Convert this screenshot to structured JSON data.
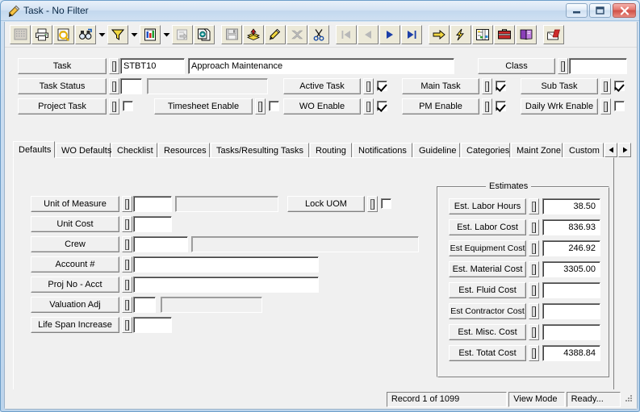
{
  "window": {
    "title": "Task - No Filter",
    "icon": "pencil-icon",
    "buttons": {
      "minimize": "minimize-icon",
      "maximize": "maximize-icon",
      "close": "close-icon"
    }
  },
  "toolbar": {
    "items": [
      {
        "name": "grid-icon",
        "enabled": false
      },
      {
        "name": "print-icon",
        "enabled": true
      },
      {
        "name": "print-preview-icon",
        "enabled": true
      },
      {
        "name": "find-icon",
        "enabled": true
      },
      {
        "name": "find-dropdown-icon",
        "enabled": true
      },
      {
        "name": "filter-icon",
        "enabled": true
      },
      {
        "name": "filter-dropdown-icon",
        "enabled": true
      },
      {
        "name": "report-icon",
        "enabled": true
      },
      {
        "name": "report-dropdown-icon",
        "enabled": true
      },
      {
        "name": "export-icon",
        "enabled": false
      },
      {
        "name": "copy-record-icon",
        "enabled": true
      },
      {
        "name": "save-icon",
        "enabled": false
      },
      {
        "name": "add-record-icon",
        "enabled": true
      },
      {
        "name": "edit-record-icon",
        "enabled": true
      },
      {
        "name": "delete-record-icon",
        "enabled": false
      },
      {
        "name": "cut-icon",
        "enabled": true
      },
      {
        "name": "first-record-icon",
        "enabled": false
      },
      {
        "name": "previous-record-icon",
        "enabled": false
      },
      {
        "name": "next-record-icon",
        "enabled": true
      },
      {
        "name": "last-record-icon",
        "enabled": true
      },
      {
        "name": "goto-icon",
        "enabled": true
      },
      {
        "name": "quick-action-icon",
        "enabled": true
      },
      {
        "name": "map-icon",
        "enabled": true
      },
      {
        "name": "toolbox-icon",
        "enabled": true
      },
      {
        "name": "help-book-icon",
        "enabled": true
      },
      {
        "name": "exit-icon",
        "enabled": true
      }
    ]
  },
  "header": {
    "task": {
      "label": "Task",
      "code": "STBT10",
      "description": "Approach Maintenance"
    },
    "task_status": {
      "label": "Task Status",
      "code": "",
      "description": ""
    },
    "project_task": {
      "label": "Project Task",
      "checked": false
    },
    "timesheet_enable": {
      "label": "Timesheet Enable",
      "checked": false
    },
    "active_task": {
      "label": "Active Task",
      "checked": true
    },
    "wo_enable": {
      "label": "WO Enable",
      "checked": true
    },
    "main_task": {
      "label": "Main Task",
      "checked": true
    },
    "pm_enable": {
      "label": "PM Enable",
      "checked": true
    },
    "sub_task": {
      "label": "Sub Task",
      "checked": true
    },
    "daily_wrk_enable": {
      "label": "Daily Wrk Enable",
      "checked": false
    },
    "class": {
      "label": "Class",
      "value": ""
    }
  },
  "tabs": {
    "items": [
      {
        "label": "Defaults",
        "active": true
      },
      {
        "label": "WO Defaults",
        "active": false
      },
      {
        "label": "Checklist",
        "active": false
      },
      {
        "label": "Resources",
        "active": false
      },
      {
        "label": "Tasks/Resulting Tasks",
        "active": false
      },
      {
        "label": "Routing",
        "active": false
      },
      {
        "label": "Notifications",
        "active": false
      },
      {
        "label": "Guideline",
        "active": false
      },
      {
        "label": "Categories",
        "active": false
      },
      {
        "label": "Maint Zone",
        "active": false
      }
    ],
    "last": {
      "label": "Custom",
      "active": false
    },
    "scroll_left": "scroll-left-icon",
    "scroll_right": "scroll-right-icon"
  },
  "defaults": {
    "unit_of_measure": {
      "label": "Unit of Measure",
      "code": "",
      "description": ""
    },
    "lock_uom": {
      "label": "Lock UOM",
      "checked": false
    },
    "unit_cost": {
      "label": "Unit Cost",
      "value": ""
    },
    "crew": {
      "label": "Crew",
      "code": "",
      "description": ""
    },
    "account_number": {
      "label": "Account #",
      "value": ""
    },
    "proj_no_acct": {
      "label": "Proj No - Acct",
      "value": ""
    },
    "valuation_adj": {
      "label": "Valuation Adj",
      "code": "",
      "description": ""
    },
    "life_span_increase": {
      "label": "Life Span Increase",
      "value": ""
    }
  },
  "estimates": {
    "title": "Estimates",
    "rows": [
      {
        "label": "Est. Labor Hours",
        "value": "38.50"
      },
      {
        "label": "Est. Labor Cost",
        "value": "836.93"
      },
      {
        "label": "Est Equipment Cost",
        "value": "246.92"
      },
      {
        "label": "Est. Material Cost",
        "value": "3305.00"
      },
      {
        "label": "Est. Fluid Cost",
        "value": ""
      },
      {
        "label": "Est Contractor Cost",
        "value": ""
      },
      {
        "label": "Est. Misc. Cost",
        "value": ""
      },
      {
        "label": "Est. Totat Cost",
        "value": "4388.84"
      }
    ]
  },
  "statusbar": {
    "record": "Record 1 of 1099",
    "mode": "View Mode",
    "state": "Ready..."
  },
  "colors": {
    "title_text": "#0b2947",
    "window_border": "#6d9ec9",
    "face": "#f0f0f0",
    "field_bg": "#ffffff",
    "close_button": "#cf4f46"
  }
}
